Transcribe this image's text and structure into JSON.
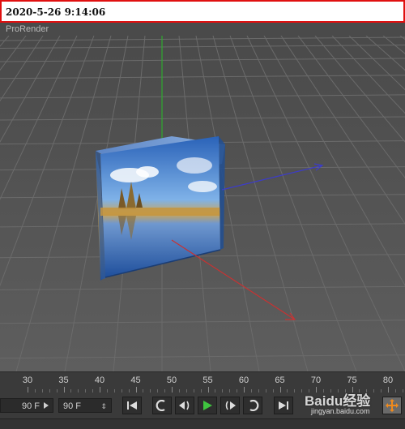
{
  "stamp": {
    "datetime": "2020-5-26 9:14:06"
  },
  "window": {
    "title": "ProRender"
  },
  "timeline": {
    "ticks": [
      "30",
      "35",
      "40",
      "45",
      "50",
      "55",
      "60",
      "65",
      "70",
      "75",
      "80"
    ]
  },
  "controls": {
    "start_frame": "90 F",
    "end_frame": "90 F"
  },
  "watermark": {
    "brand": "Baidu经验",
    "url": "jingyan.baidu.com"
  },
  "colors": {
    "x_axis": "#3c3cc8",
    "y_axis": "#2faa2f",
    "z_axis": "#c83232",
    "stamp_border": "#e01010"
  },
  "icons": [
    "first-frame-icon",
    "prev-key-icon",
    "prev-frame-icon",
    "play-icon",
    "next-frame-icon",
    "next-key-icon",
    "last-frame-icon",
    "move-tool-icon"
  ]
}
